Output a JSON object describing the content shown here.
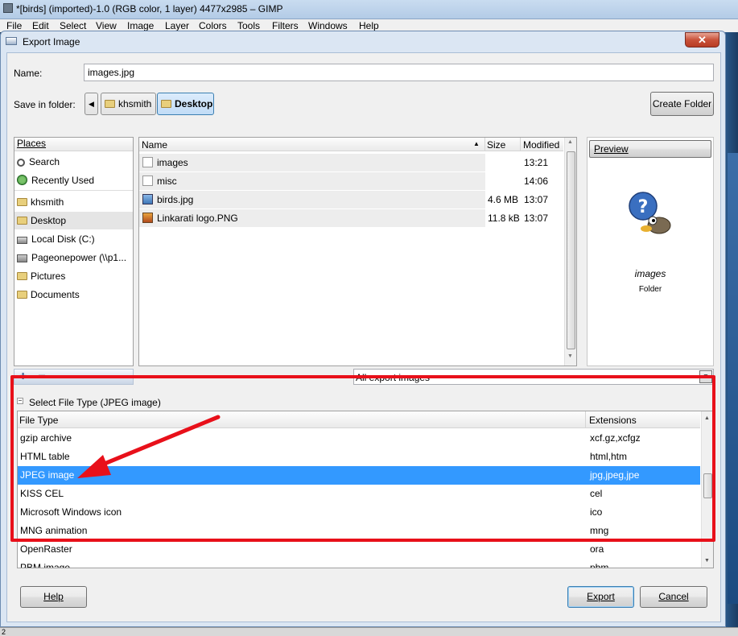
{
  "bg_window": {
    "title": "*[birds] (imported)-1.0 (RGB color, 1 layer) 4477x2985 – GIMP",
    "menu": [
      "File",
      "Edit",
      "Select",
      "View",
      "Image",
      "Layer",
      "Colors",
      "Tools",
      "Filters",
      "Windows",
      "Help"
    ],
    "status_num": "2"
  },
  "dialog": {
    "title": "Export Image",
    "close_glyph": "✕"
  },
  "name_row": {
    "label": "Name:",
    "value": "images.jpg"
  },
  "folder_row": {
    "label": "Save in folder:",
    "left_arrow": "◀",
    "crumbs": [
      "khsmith",
      "Desktop"
    ],
    "create_folder": "Create Folder"
  },
  "places": {
    "header": "Places",
    "items": [
      {
        "label": "Search",
        "icon": "search-icon"
      },
      {
        "label": "Recently Used",
        "icon": "recent-icon"
      },
      {
        "label": "khsmith",
        "icon": "folder-icon"
      },
      {
        "label": "Desktop",
        "icon": "folder-icon"
      },
      {
        "label": "Local Disk (C:)",
        "icon": "disk-icon"
      },
      {
        "label": "Pageonepower (\\\\p1...",
        "icon": "network-drive-icon"
      },
      {
        "label": "Pictures",
        "icon": "folder-icon"
      },
      {
        "label": "Documents",
        "icon": "folder-icon"
      }
    ],
    "add": "✚",
    "remove": "▬"
  },
  "files": {
    "columns": {
      "name": "Name",
      "size": "Size",
      "modified": "Modified"
    },
    "rows": [
      {
        "name": "images",
        "size": "",
        "modified": "13:21",
        "icon": "file-icon"
      },
      {
        "name": "misc",
        "size": "",
        "modified": "14:06",
        "icon": "file-icon"
      },
      {
        "name": "birds.jpg",
        "size": "4.6 MB",
        "modified": "13:07",
        "icon": "image-icon"
      },
      {
        "name": "Linkarati logo.PNG",
        "size": "11.8 kB",
        "modified": "13:07",
        "icon": "png-icon"
      }
    ]
  },
  "preview": {
    "header": "Preview",
    "name": "images",
    "kind": "Folder"
  },
  "filter": {
    "value": "All export images"
  },
  "filetype": {
    "expander": "Select File Type (JPEG image)",
    "columns": {
      "type": "File Type",
      "ext": "Extensions"
    },
    "rows": [
      {
        "type": "gzip archive",
        "ext": "xcf.gz,xcfgz"
      },
      {
        "type": "HTML table",
        "ext": "html,htm"
      },
      {
        "type": "JPEG image",
        "ext": "jpg,jpeg,jpe",
        "selected": true
      },
      {
        "type": "KISS CEL",
        "ext": "cel"
      },
      {
        "type": "Microsoft Windows icon",
        "ext": "ico"
      },
      {
        "type": "MNG animation",
        "ext": "mng"
      },
      {
        "type": "OpenRaster",
        "ext": "ora"
      },
      {
        "type": "PBM image",
        "ext": "pbm"
      }
    ]
  },
  "buttons": {
    "help": "Help",
    "export": "Export",
    "cancel": "Cancel"
  },
  "colors": {
    "selected": "#3399ff",
    "annotation": "#e8101a"
  }
}
